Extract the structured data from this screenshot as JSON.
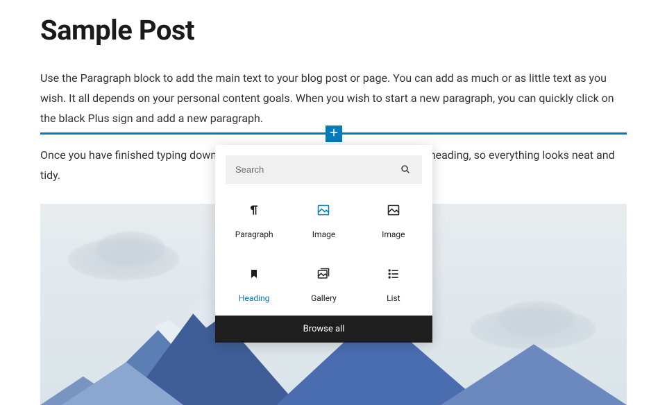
{
  "post": {
    "title": "Sample Post",
    "paragraph1": "Use the Paragraph block to add the main text to your blog post or page. You can add as much or as little text as you wish. It all depends on your personal content goals. When you wish to start a new paragraph, you can quickly click on the black Plus sign and add a new paragraph.",
    "paragraph2": "Once you have finished typing down the body of content, it is time to add some heading, so everything looks neat and tidy."
  },
  "inserter": {
    "search_placeholder": "Search",
    "browse_all_label": "Browse all",
    "blocks": {
      "paragraph": "Paragraph",
      "image1": "Image",
      "image2": "Image",
      "heading": "Heading",
      "gallery": "Gallery",
      "list": "List"
    }
  }
}
